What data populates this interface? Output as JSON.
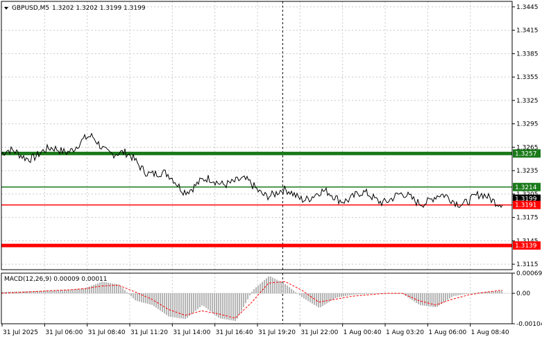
{
  "header": {
    "symbol": "GBPUSD,M5",
    "ohlc": "1.3202 1.3202 1.3199 1.3199"
  },
  "chart_data": [
    {
      "type": "line",
      "symbol": "GBPUSD,M5",
      "ylim": [
        1.3108,
        1.3452
      ],
      "y_ticks": [
        "1.3445",
        "1.3415",
        "1.3385",
        "1.3355",
        "1.3325",
        "1.3295",
        "1.3265",
        "1.3235",
        "1.3205",
        "1.3175",
        "1.3145",
        "1.3115"
      ],
      "x_ticks": [
        "31 Jul 2025",
        "31 Jul 06:00",
        "31 Jul 08:40",
        "31 Jul 11:20",
        "31 Jul 14:00",
        "31 Jul 16:40",
        "31 Jul 19:20",
        "31 Jul 22:00",
        "1 Aug 00:40",
        "1 Aug 03:20",
        "1 Aug 06:00",
        "1 Aug 08:40"
      ],
      "grid": true,
      "series": [
        {
          "x": [
            "31 Jul 2025",
            "31 Jul 06:00",
            "31 Jul 08:40",
            "31 Jul 11:20",
            "31 Jul 14:00",
            "31 Jul 16:40",
            "31 Jul 19:20",
            "31 Jul 22:00",
            "1 Aug 00:40",
            "1 Aug 03:20",
            "1 Aug 06:00",
            "1 Aug 08:40"
          ],
          "values": [
            1.3255,
            1.3257,
            1.3274,
            1.3244,
            1.3214,
            1.3224,
            1.3205,
            1.3203,
            1.3201,
            1.3199,
            1.3198,
            1.3199
          ]
        }
      ],
      "levels": [
        {
          "label": "1.3257",
          "value": 1.3257,
          "color": "#1a7a1a",
          "style": "thick"
        },
        {
          "label": "1.3214",
          "value": 1.3214,
          "color": "#1a7a1a",
          "style": "thin"
        },
        {
          "label": "1.3199",
          "value": 1.3199,
          "color": "#000000",
          "style": "price"
        },
        {
          "label": "1.3191",
          "value": 1.3191,
          "color": "#ff0000",
          "style": "thin"
        },
        {
          "label": "1.3139",
          "value": 1.3139,
          "color": "#ff0000",
          "style": "thick"
        }
      ]
    },
    {
      "type": "bar",
      "title": "MACD(12,26,9) 0.00009 0.00011",
      "ylim": [
        -0.00104,
        0.00069
      ],
      "y_ticks": [
        "0.00069",
        "0.00",
        "-0.00104"
      ],
      "histogram": [
        5e-05,
        6e-05,
        8e-05,
        0.0001,
        0.00012,
        0.00018,
        0.0004,
        0.0003,
        -0.00025,
        -0.0004,
        -0.0008,
        -0.00088,
        -0.0004,
        -0.00085,
        -0.00095,
        0.0001,
        0.0006,
        0.0003,
        -0.00015,
        -0.0005,
        -0.00015,
        -5e-05,
        -2e-05,
        0.0,
        -2e-05,
        -0.0004,
        -0.00048,
        -0.0001,
        0.0,
        5e-05,
        9e-05
      ],
      "signal": [
        0.0,
        3e-05,
        6e-05,
        9e-05,
        0.00012,
        0.00016,
        0.00025,
        0.00028,
        5e-05,
        -0.0002,
        -0.00055,
        -0.00075,
        -0.0006,
        -0.0007,
        -0.00085,
        -0.0003,
        0.00035,
        0.0004,
        0.0001,
        -0.0003,
        -0.0002,
        -0.0001,
        -5e-05,
        0.0,
        0.0,
        -0.00025,
        -0.0004,
        -0.0002,
        -5e-05,
        4e-05,
        0.00011
      ]
    }
  ],
  "colors": {
    "grid": "#c8c8c8",
    "price_line": "#000000",
    "histogram": "#b4b4b4",
    "signal": "#ff0000",
    "support": "#ff0000",
    "resistance": "#1a7a1a"
  }
}
